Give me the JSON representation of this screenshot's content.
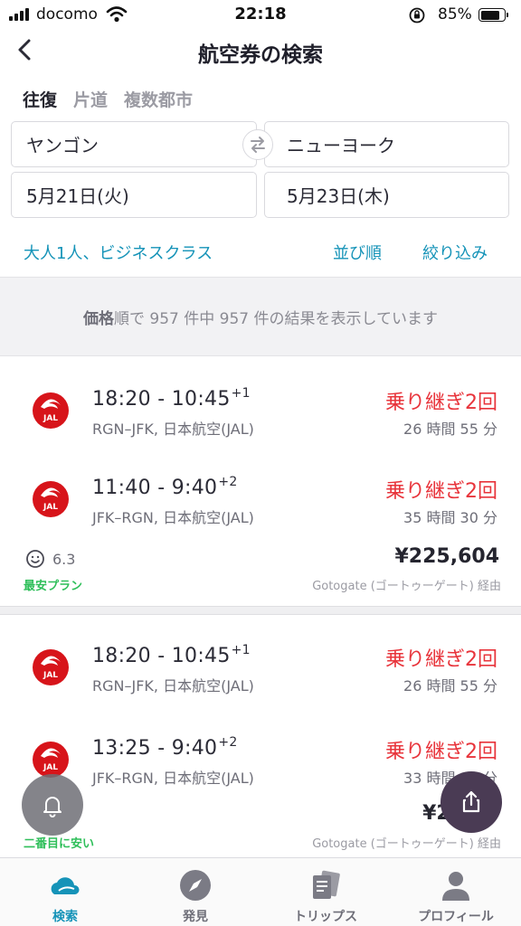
{
  "status_bar": {
    "carrier": "docomo",
    "time": "22:18",
    "battery": "85%"
  },
  "header": {
    "title": "航空券の検索"
  },
  "trip_types": [
    {
      "label": "往復",
      "active": true
    },
    {
      "label": "片道",
      "active": false
    },
    {
      "label": "複数都市",
      "active": false
    }
  ],
  "search": {
    "origin": "ヤンゴン",
    "destination": "ニューヨーク",
    "depart_date": "5月21日(火)",
    "return_date": "5月23日(木)",
    "passengers": "大人1人、ビジネスクラス",
    "sort_label": "並び順",
    "filter_label": "絞り込み"
  },
  "summary": {
    "bold": "価格",
    "rest": "順で 957 件中 957 件の結果を表示しています"
  },
  "results": [
    {
      "legs": [
        {
          "time": "18:20 - 10:45",
          "plus": "+1",
          "route": "RGN–JFK, 日本航空(JAL)",
          "stops": "乗り継ぎ2回",
          "duration": "26 時間 55 分"
        },
        {
          "time": "11:40 - 9:40",
          "plus": "+2",
          "route": "JFK–RGN, 日本航空(JAL)",
          "stops": "乗り継ぎ2回",
          "duration": "35 時間 30 分"
        }
      ],
      "rating": "6.3",
      "badge": "最安プラン",
      "price": "¥225,604",
      "via": "Gotogate (ゴートゥーゲート) 経由"
    },
    {
      "legs": [
        {
          "time": "18:20 - 10:45",
          "plus": "+1",
          "route": "RGN–JFK, 日本航空(JAL)",
          "stops": "乗り継ぎ2回",
          "duration": "26 時間 55 分"
        },
        {
          "time": "13:25 - 9:40",
          "plus": "+2",
          "route": "JFK–RGN, 日本航空(JAL)",
          "stops": "乗り継ぎ2回",
          "duration": "33 時間 45 分"
        }
      ],
      "badge": "二番目に安い",
      "price": "¥226,8",
      "via": "Gotogate (ゴートゥーゲート) 経由"
    }
  ],
  "tabbar": [
    {
      "label": "検索",
      "active": true
    },
    {
      "label": "発見",
      "active": false
    },
    {
      "label": "トリップス",
      "active": false
    },
    {
      "label": "プロフィール",
      "active": false
    }
  ],
  "colors": {
    "accent": "#1593b8",
    "stops_red": "#e8343b",
    "badge_green": "#2fbf5a",
    "jal_red": "#d7141a"
  }
}
